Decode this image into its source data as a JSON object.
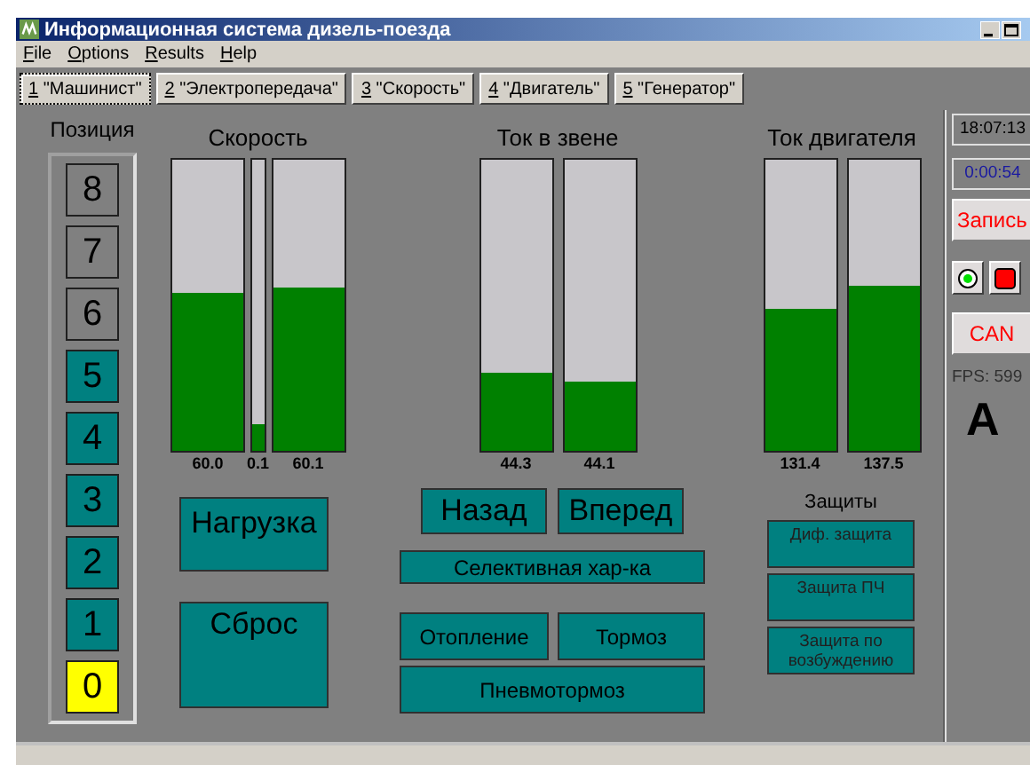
{
  "window": {
    "title": "Информационная система дизель-поезда"
  },
  "menu": [
    "File",
    "Options",
    "Results",
    "Help"
  ],
  "tabs": [
    {
      "label": "1 \"Машинист\"",
      "selected": true
    },
    {
      "label": "2 \"Электропередача\"",
      "selected": false
    },
    {
      "label": "3 \"Скорость\"",
      "selected": false
    },
    {
      "label": "4 \"Двигатель\"",
      "selected": false
    },
    {
      "label": "5 \"Генератор\"",
      "selected": false
    }
  ],
  "positions": {
    "title": "Позиция",
    "items": [
      {
        "label": "8",
        "enabled": false,
        "selected": false
      },
      {
        "label": "7",
        "enabled": false,
        "selected": false
      },
      {
        "label": "6",
        "enabled": false,
        "selected": false
      },
      {
        "label": "5",
        "enabled": true,
        "selected": false
      },
      {
        "label": "4",
        "enabled": true,
        "selected": false
      },
      {
        "label": "3",
        "enabled": true,
        "selected": false
      },
      {
        "label": "2",
        "enabled": true,
        "selected": false
      },
      {
        "label": "1",
        "enabled": true,
        "selected": false
      },
      {
        "label": "0",
        "enabled": true,
        "selected": true
      }
    ]
  },
  "gauges": [
    {
      "title": "Скорость",
      "bars": [
        {
          "kind": "wide",
          "level": 0.54,
          "reading": "60.0"
        },
        {
          "kind": "thin",
          "level": 0.09,
          "reading": "0.1"
        },
        {
          "kind": "wide",
          "level": 0.56,
          "reading": "60.1"
        }
      ]
    },
    {
      "title": "Ток в звене",
      "bars": [
        {
          "kind": "wide",
          "level": 0.27,
          "reading": "44.3"
        },
        {
          "kind": "wide",
          "level": 0.24,
          "reading": "44.1"
        }
      ]
    },
    {
      "title": "Ток двигателя",
      "bars": [
        {
          "kind": "wide",
          "level": 0.49,
          "reading": "131.4"
        },
        {
          "kind": "wide",
          "level": 0.57,
          "reading": "137.5"
        }
      ]
    }
  ],
  "load_buttons": [
    "Нагрузка",
    "Сброс"
  ],
  "direction_buttons": [
    "Назад",
    "Вперед"
  ],
  "selective_button": "Селективная хар-ка",
  "heat_buttons": [
    "Отопление",
    "Тормоз"
  ],
  "pneumo_button": "Пневмотормоз",
  "protections": {
    "title": "Защиты",
    "items": [
      "Диф. защита",
      "Защита ПЧ",
      "Защита по возбуждению"
    ]
  },
  "side": {
    "clock": "18:07:13",
    "elapsed": "0:00:54",
    "record_button": "Запись",
    "can_button": "CAN",
    "fps": "FPS: 599",
    "mode": "A"
  }
}
